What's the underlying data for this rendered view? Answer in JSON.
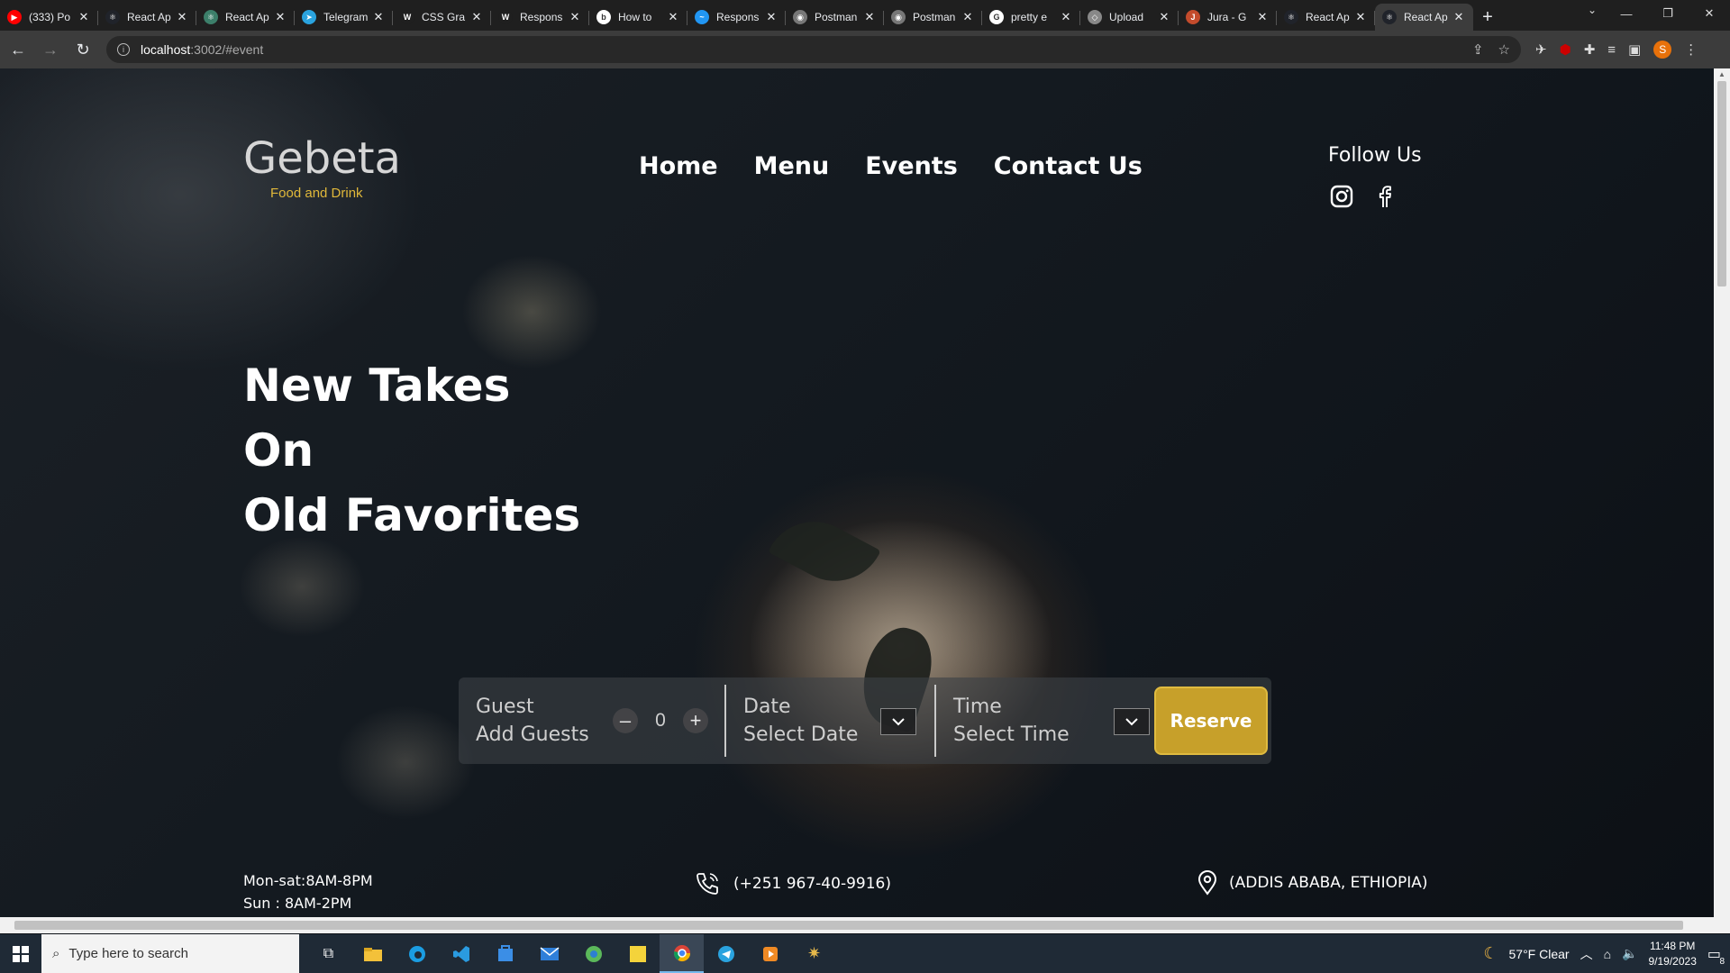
{
  "browser": {
    "tabs": [
      {
        "title": "(333) Po",
        "color": "#ff0000",
        "glyph": "▶"
      },
      {
        "title": "React Ap",
        "color": "#20232a",
        "glyph": "⚛"
      },
      {
        "title": "React Ap",
        "color": "#3c7f6a",
        "glyph": "⚛"
      },
      {
        "title": "Telegram",
        "color": "#2aa3df",
        "glyph": "➤"
      },
      {
        "title": "CSS Gra",
        "color": "#1f1f1f",
        "glyph": "W"
      },
      {
        "title": "Respons",
        "color": "#1f1f1f",
        "glyph": "W"
      },
      {
        "title": "How to",
        "color": "#ffffff",
        "glyph": "b"
      },
      {
        "title": "Respons",
        "color": "#2196f3",
        "glyph": "~"
      },
      {
        "title": "Postman",
        "color": "#777777",
        "glyph": "◉"
      },
      {
        "title": "Postman",
        "color": "#777777",
        "glyph": "◉"
      },
      {
        "title": "pretty e",
        "color": "#ffffff",
        "glyph": "G"
      },
      {
        "title": "Upload",
        "color": "#888888",
        "glyph": "◇"
      },
      {
        "title": "Jura - G",
        "color": "#c34b2c",
        "glyph": "J"
      },
      {
        "title": "React Ap",
        "color": "#20232a",
        "glyph": "⚛"
      },
      {
        "title": "React Ap",
        "color": "#20232a",
        "glyph": "⚛"
      }
    ],
    "active_tab_index": 14,
    "url_host": "localhost",
    "url_path": ":3002/#event",
    "profile_initial": "S"
  },
  "site": {
    "logo": "Gebeta",
    "tagline": "Food and Drink",
    "nav": [
      "Home",
      "Menu",
      "Events",
      "Contact Us"
    ],
    "follow_title": "Follow Us",
    "social_icons": [
      "instagram-icon",
      "facebook-icon"
    ],
    "headline": [
      "New Takes",
      "On",
      "Old Favorites"
    ],
    "reservation": {
      "guest_label": "Guest",
      "guest_placeholder": "Add Guests",
      "guest_count": "0",
      "minus": "–",
      "plus": "+",
      "date_label": "Date",
      "date_placeholder": "Select Date",
      "time_label": "Time",
      "time_placeholder": "Select Time",
      "button": "Reserve"
    },
    "hours": [
      "Mon-sat:8AM-8PM",
      "Sun : 8AM-2PM"
    ],
    "phone": "(+251 967-40-9916)",
    "address": "(ADDIS ABABA, ETHIOPIA)",
    "accent_color": "#c7a02a"
  },
  "taskbar": {
    "search_placeholder": "Type here to search",
    "weather": "57°F  Clear",
    "time": "11:48 PM",
    "date": "9/19/2023",
    "notifications": "8"
  }
}
